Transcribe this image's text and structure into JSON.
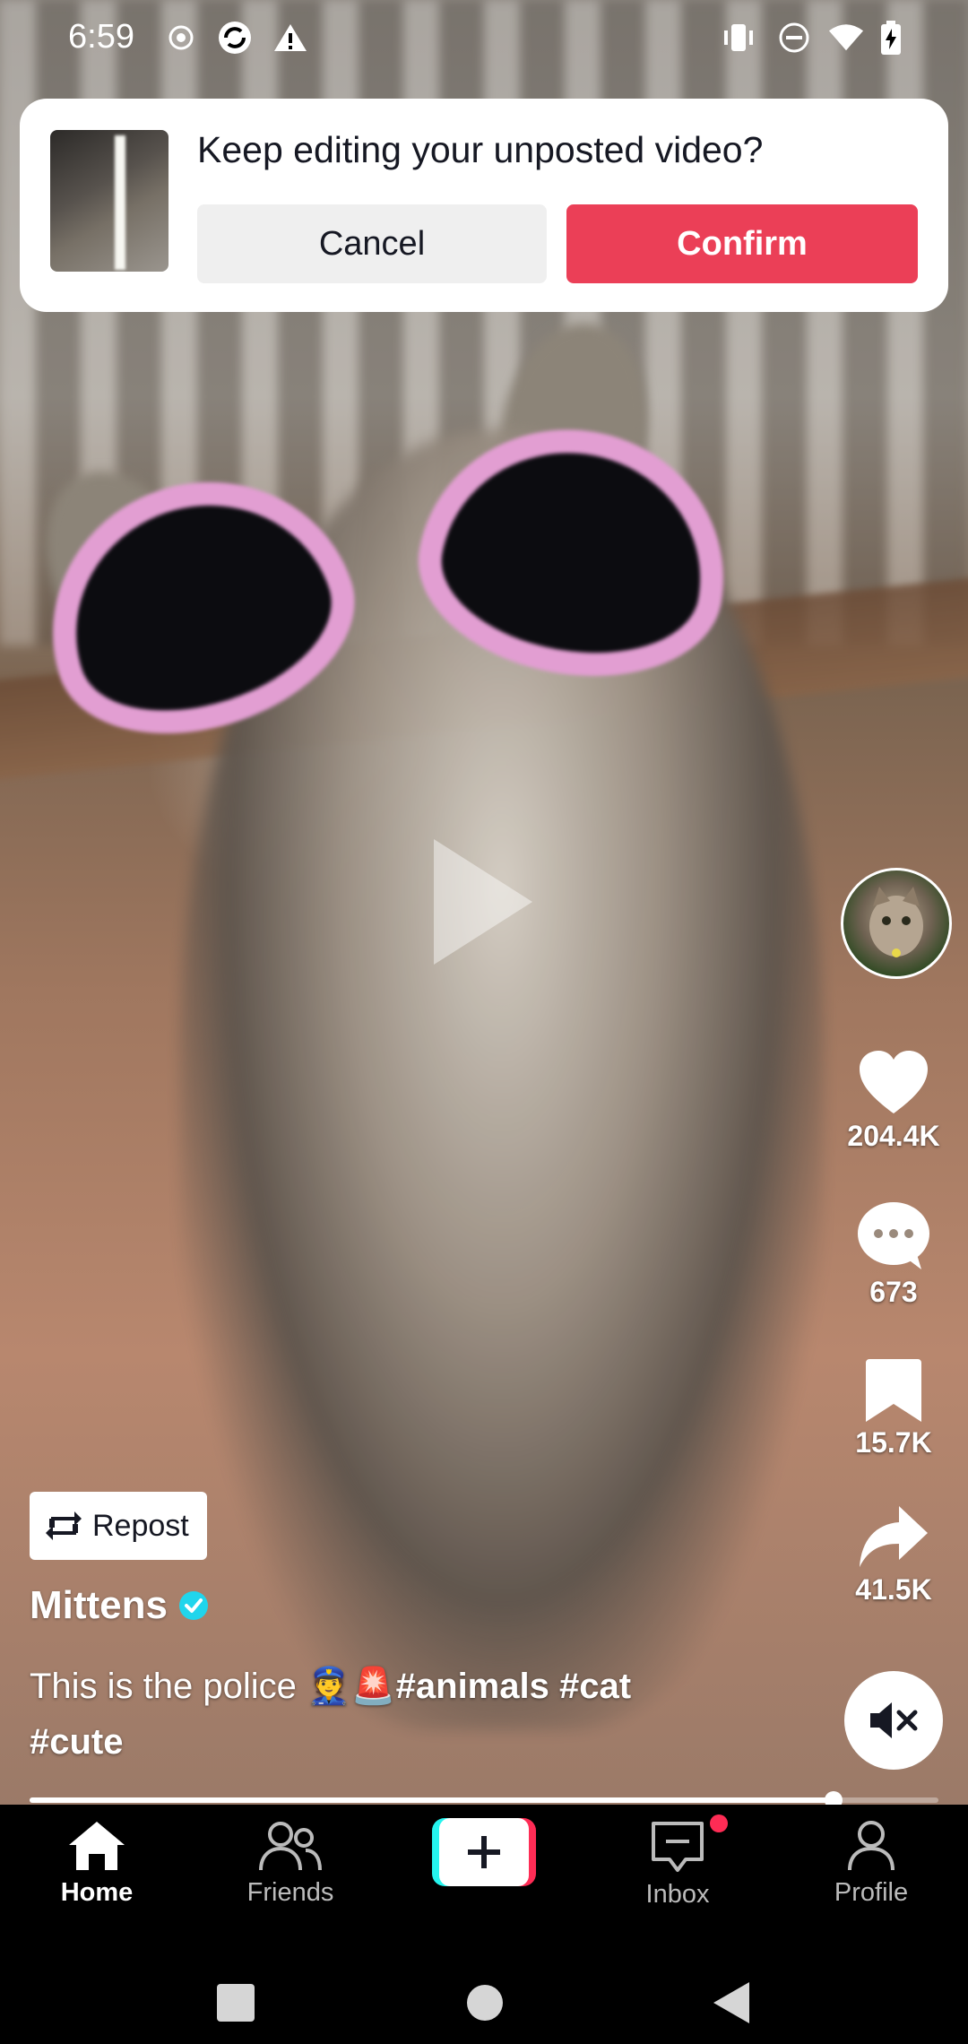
{
  "status_bar": {
    "time": "6:59",
    "left_icons": [
      "record-icon",
      "sync-icon",
      "warning-icon"
    ],
    "right_icons": [
      "vibrate-icon",
      "do-not-disturb-icon",
      "wifi-icon",
      "battery-charging-icon"
    ]
  },
  "draft_dialog": {
    "title": "Keep editing your unposted video?",
    "cancel_label": "Cancel",
    "confirm_label": "Confirm",
    "confirm_color": "#eb3f57"
  },
  "video": {
    "state": "paused",
    "progress_fraction": 0.885
  },
  "post": {
    "repost_label": "Repost",
    "username": "Mittens",
    "verified": true,
    "caption_text": "This is the police 👮🚨",
    "caption_tags": [
      "#animals",
      "#cat",
      "#cute"
    ]
  },
  "actions": {
    "likes": "204.4K",
    "comments": "673",
    "saves": "15.7K",
    "shares": "41.5K",
    "sound": "muted"
  },
  "bottom_nav": {
    "items": [
      {
        "label": "Home",
        "icon": "home-icon",
        "active": true
      },
      {
        "label": "Friends",
        "icon": "friends-icon",
        "active": false
      },
      {
        "label": "",
        "icon": "plus-icon",
        "active": false
      },
      {
        "label": "Inbox",
        "icon": "inbox-icon",
        "active": false,
        "badge": true
      },
      {
        "label": "Profile",
        "icon": "profile-icon",
        "active": false
      }
    ]
  },
  "colors": {
    "accent": "#fe2c55",
    "accent_cyan": "#25f4ee",
    "verified": "#20d5ec"
  }
}
